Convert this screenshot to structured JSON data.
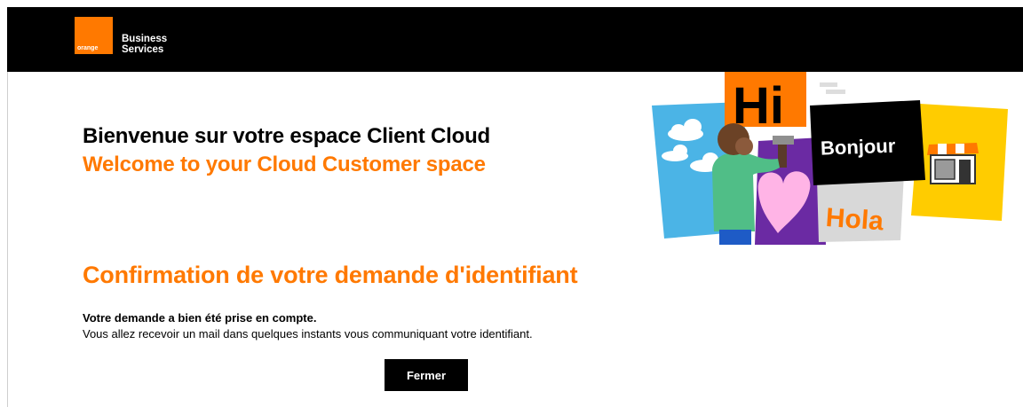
{
  "header": {
    "logo_small": "orange",
    "logo_line1": "Business",
    "logo_line2": "Services"
  },
  "welcome": {
    "french": "Bienvenue sur votre espace Client Cloud",
    "english": "Welcome to your Cloud Customer space"
  },
  "illustration": {
    "greeting_hi": "Hi",
    "greeting_bonjour": "Bonjour",
    "greeting_hola": "Hola"
  },
  "confirmation": {
    "title": "Confirmation de votre demande d'identifiant",
    "message_bold": "Votre demande a bien été prise en compte.",
    "message": "Vous allez recevoir un mail dans quelques instants vous communiquant votre identifiant.",
    "close_label": "Fermer"
  },
  "colors": {
    "brand_orange": "#ff7900",
    "header_bg": "#000000",
    "button_bg": "#000000"
  }
}
